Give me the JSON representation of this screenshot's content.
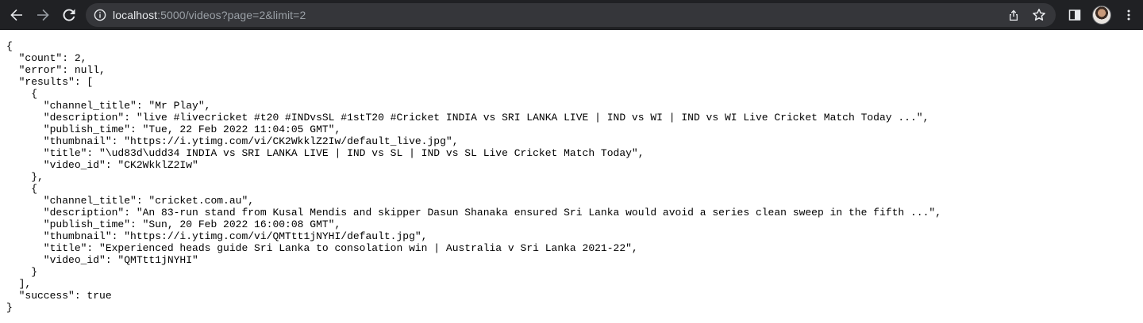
{
  "browser": {
    "url_host": "localhost",
    "url_rest": ":5000/videos?page=2&limit=2",
    "icons": {
      "back": "back-arrow-icon",
      "forward": "forward-arrow-icon",
      "reload": "reload-icon",
      "info": "info-icon",
      "share": "share-icon",
      "bookmark": "star-icon",
      "sidepanel": "side-panel-icon",
      "profile": "profile-avatar",
      "menu": "kebab-menu-icon"
    },
    "colors": {
      "toolbar": "#202124",
      "omnibox": "#35363a",
      "host_text": "#e8eaed",
      "url_rest_text": "#9aa0a6"
    }
  },
  "json_lines": [
    "{",
    "  \"count\": 2,",
    "  \"error\": null,",
    "  \"results\": [",
    "    {",
    "      \"channel_title\": \"Mr Play\",",
    "      \"description\": \"live #livecricket #t20 #INDvsSL #1stT20 #Cricket INDIA vs SRI LANKA LIVE | IND vs WI | IND vs WI Live Cricket Match Today ...\",",
    "      \"publish_time\": \"Tue, 22 Feb 2022 11:04:05 GMT\",",
    "      \"thumbnail\": \"https://i.ytimg.com/vi/CK2WkklZ2Iw/default_live.jpg\",",
    "      \"title\": \"\\ud83d\\udd34 INDIA vs SRI LANKA LIVE | IND vs SL | IND vs SL Live Cricket Match Today\",",
    "      \"video_id\": \"CK2WkklZ2Iw\"",
    "    },",
    "    {",
    "      \"channel_title\": \"cricket.com.au\",",
    "      \"description\": \"An 83-run stand from Kusal Mendis and skipper Dasun Shanaka ensured Sri Lanka would avoid a series clean sweep in the fifth ...\",",
    "      \"publish_time\": \"Sun, 20 Feb 2022 16:00:08 GMT\",",
    "      \"thumbnail\": \"https://i.ytimg.com/vi/QMTtt1jNYHI/default.jpg\",",
    "      \"title\": \"Experienced heads guide Sri Lanka to consolation win | Australia v Sri Lanka 2021-22\",",
    "      \"video_id\": \"QMTtt1jNYHI\"",
    "    }",
    "  ],",
    "  \"success\": true",
    "}"
  ]
}
